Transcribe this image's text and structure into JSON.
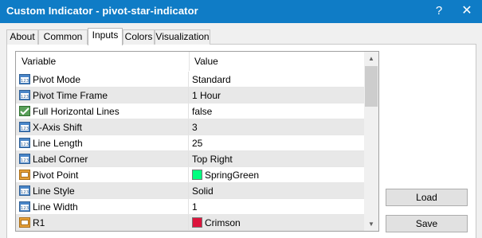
{
  "window": {
    "title": "Custom Indicator - pivot-star-indicator",
    "help_glyph": "?",
    "close_glyph": "✕"
  },
  "tabs": [
    {
      "label": "About"
    },
    {
      "label": "Common"
    },
    {
      "label": "Inputs"
    },
    {
      "label": "Colors"
    },
    {
      "label": "Visualization"
    }
  ],
  "active_tab": "Inputs",
  "grid": {
    "headers": {
      "variable": "Variable",
      "value": "Value"
    },
    "rows": [
      {
        "icon": "int-icon",
        "variable": "Pivot Mode",
        "value": "Standard"
      },
      {
        "icon": "int-icon",
        "variable": "Pivot Time Frame",
        "value": "1 Hour"
      },
      {
        "icon": "bool-icon",
        "variable": "Full Horizontal Lines",
        "value": "false"
      },
      {
        "icon": "int-icon",
        "variable": "X-Axis Shift",
        "value": "3"
      },
      {
        "icon": "int-icon",
        "variable": "Line Length",
        "value": "25"
      },
      {
        "icon": "int-icon",
        "variable": "Label Corner",
        "value": "Top Right"
      },
      {
        "icon": "color-icon",
        "variable": "Pivot Point",
        "value": "SpringGreen",
        "swatch": "#00ff7f"
      },
      {
        "icon": "int-icon",
        "variable": "Line Style",
        "value": "Solid"
      },
      {
        "icon": "int-icon",
        "variable": "Line Width",
        "value": "1"
      },
      {
        "icon": "color-icon",
        "variable": "R1",
        "value": "Crimson",
        "swatch": "#dc143c"
      }
    ]
  },
  "buttons": {
    "load": "Load",
    "save": "Save"
  },
  "colors": {
    "titlebar": "#0f7cc6",
    "row_alt": "#e8e8e8"
  }
}
